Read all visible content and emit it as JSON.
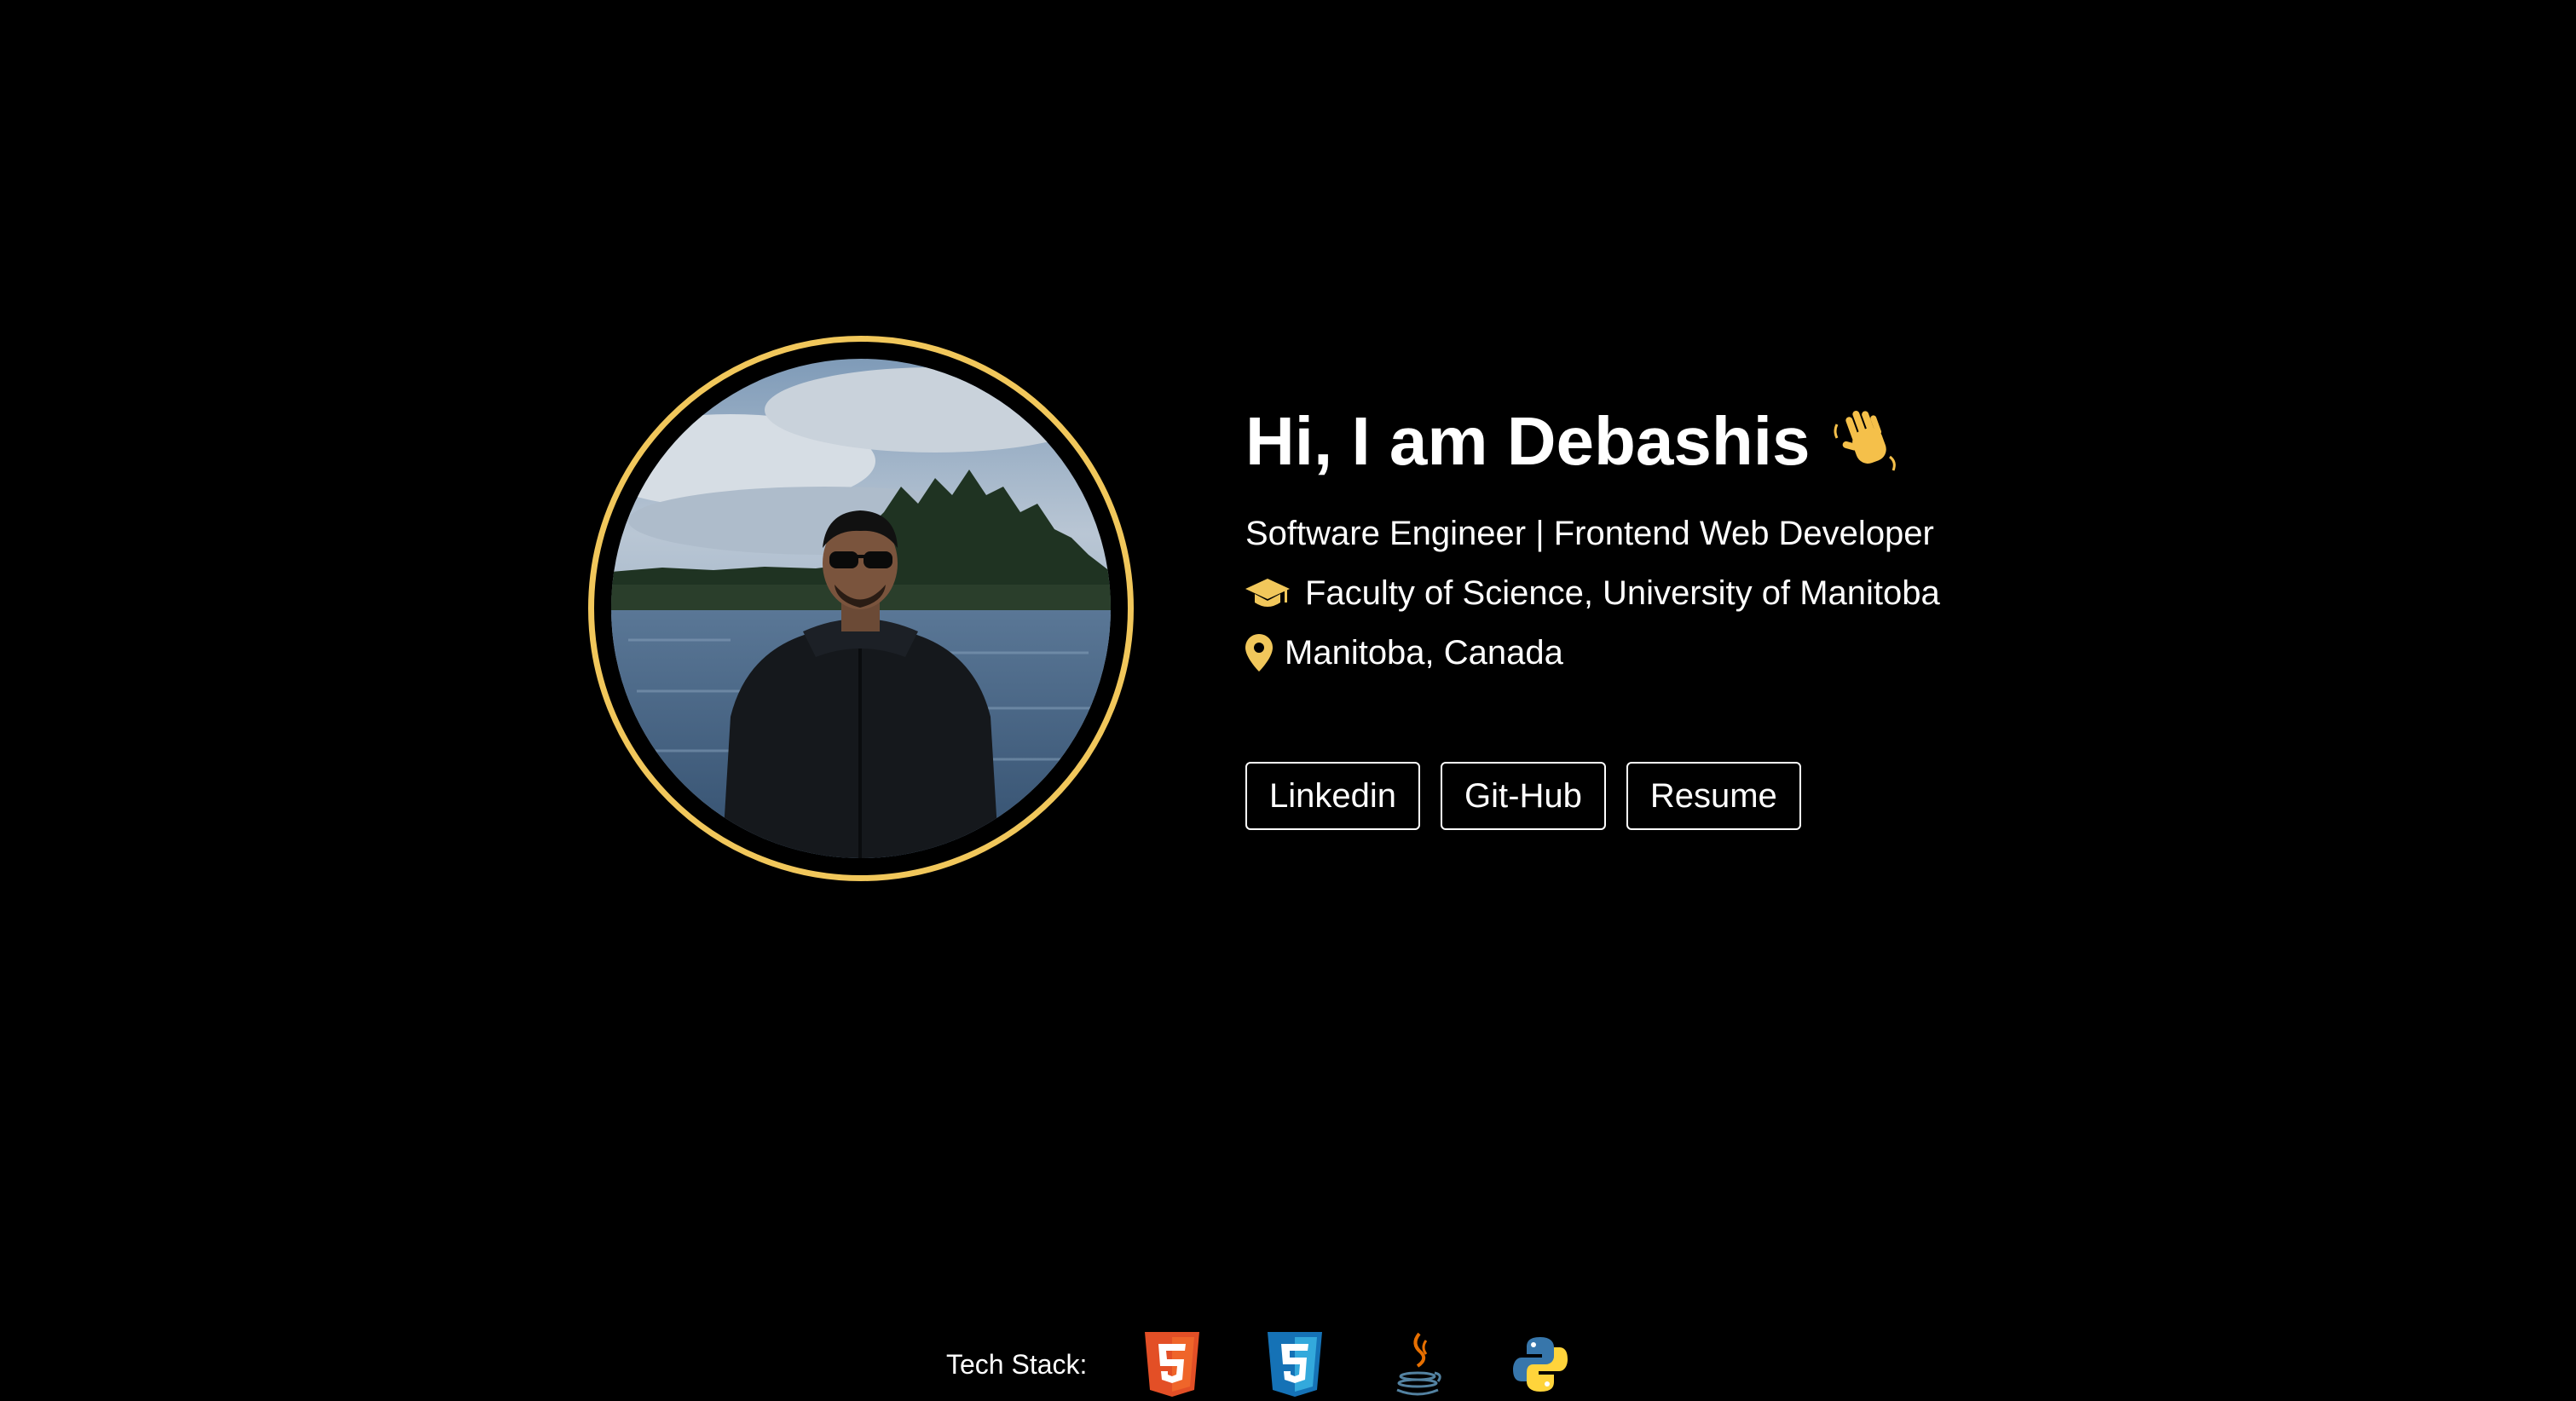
{
  "profile": {
    "greeting": "Hi, I am Debashis",
    "wave_icon": "waving-hand-icon",
    "role": "Software Engineer | Frontend Web Developer",
    "education_icon": "graduation-cap-icon",
    "education": "Faculty of Science, University of Manitoba",
    "location_icon": "map-pin-icon",
    "location": "Manitoba, Canada"
  },
  "links": {
    "linkedin": "Linkedin",
    "github": "Git-Hub",
    "resume": "Resume"
  },
  "tech_stack": {
    "label": "Tech Stack:",
    "icons": [
      "html5-icon",
      "css3-icon",
      "java-icon",
      "python-icon"
    ]
  },
  "colors": {
    "background": "#000000",
    "text": "#ffffff",
    "accent": "#f1c75b",
    "html5": "#e34f26",
    "css3": "#1572b6",
    "java_red": "#e76f00",
    "java_blue": "#5382a1",
    "python_blue": "#3776ab",
    "python_yellow": "#ffd43b"
  }
}
